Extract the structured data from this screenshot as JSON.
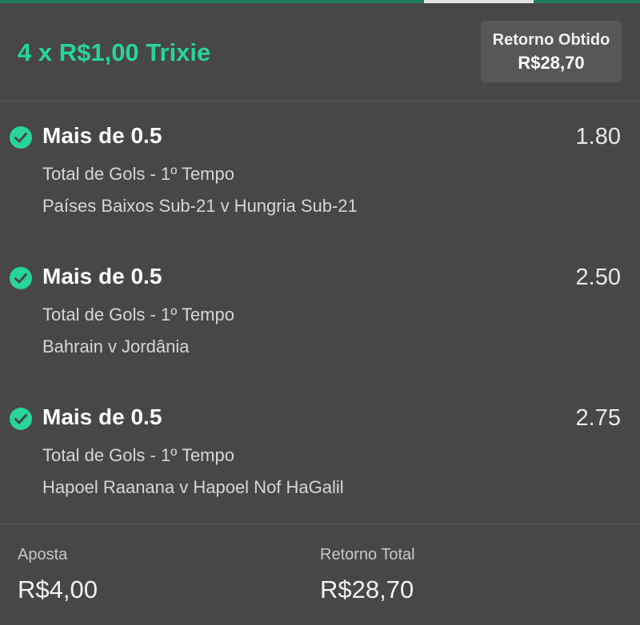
{
  "colors": {
    "accent_green": "#27d59c",
    "background": "#474747",
    "return_box_bg": "#575757"
  },
  "header": {
    "title": "4 x R$1,00 Trixie",
    "return_label": "Retorno Obtido",
    "return_value": "R$28,70"
  },
  "selections": [
    {
      "status_icon": "check-circle-icon",
      "name": "Mais de 0.5",
      "odds": "1.80",
      "market": "Total de Gols - 1º Tempo",
      "event": "Países Baixos Sub-21 v Hungria Sub-21"
    },
    {
      "status_icon": "check-circle-icon",
      "name": "Mais de 0.5",
      "odds": "2.50",
      "market": "Total de Gols - 1º Tempo",
      "event": "Bahrain v Jordânia"
    },
    {
      "status_icon": "check-circle-icon",
      "name": "Mais de 0.5",
      "odds": "2.75",
      "market": "Total de Gols - 1º Tempo",
      "event": "Hapoel Raanana v Hapoel Nof HaGalil"
    }
  ],
  "footer": {
    "stake_label": "Aposta",
    "stake_value": "R$4,00",
    "total_return_label": "Retorno Total",
    "total_return_value": "R$28,70"
  }
}
